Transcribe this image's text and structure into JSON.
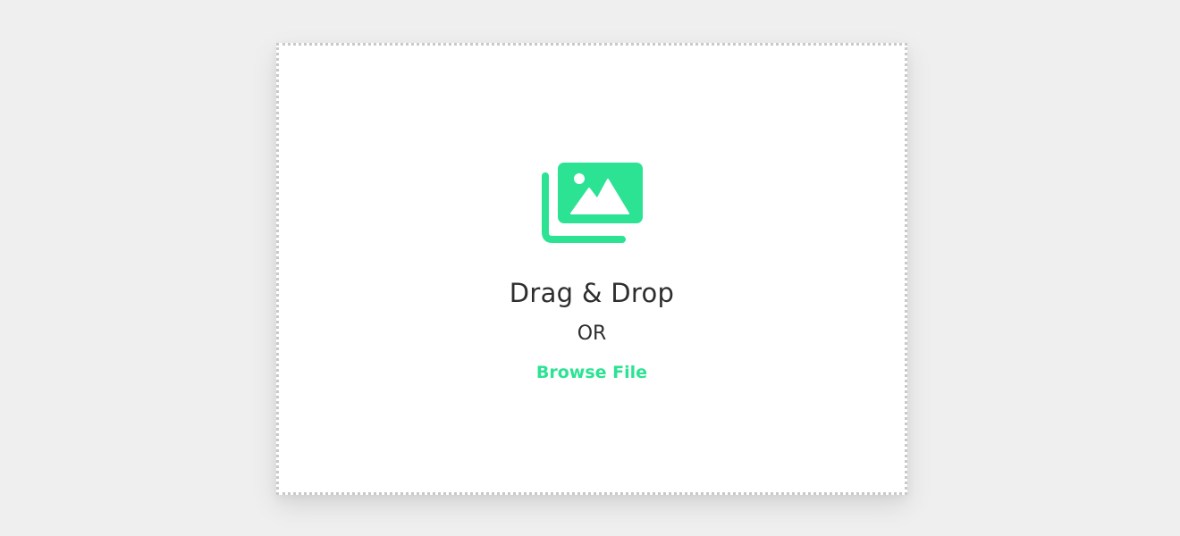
{
  "dropzone": {
    "icon": "images-icon",
    "title": "Drag & Drop",
    "separator": "OR",
    "browse_label": "Browse File"
  },
  "colors": {
    "accent": "#2be393",
    "text": "#2e2e2e",
    "background": "#efefef",
    "border": "#c9c9c9"
  }
}
